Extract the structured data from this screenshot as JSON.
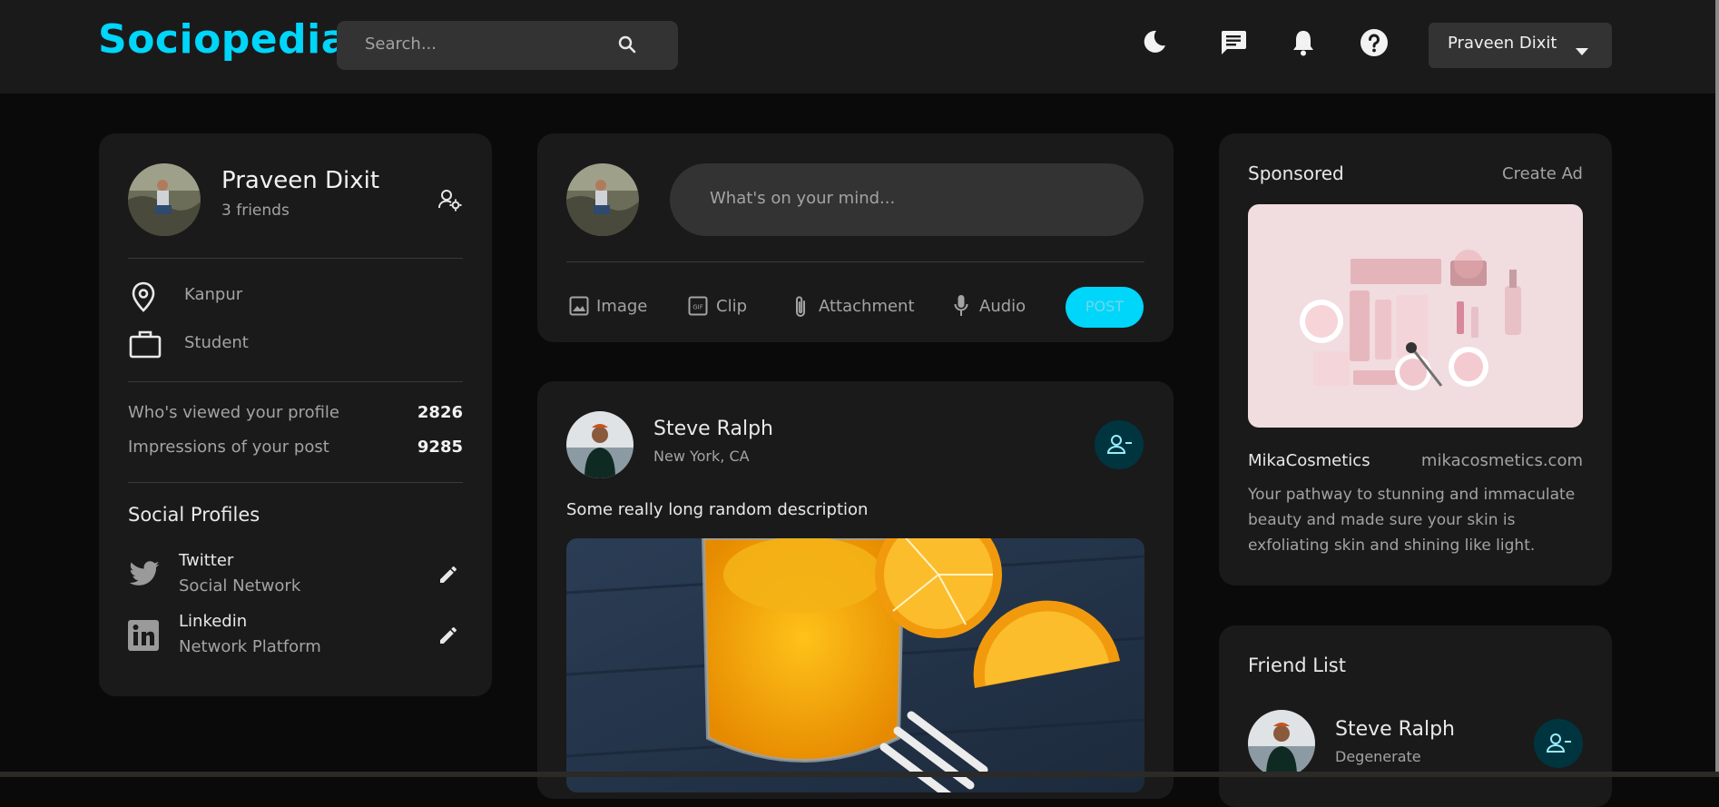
{
  "header": {
    "logo": "Sociopedia",
    "search_placeholder": "Search...",
    "user_name": "Praveen Dixit"
  },
  "profile": {
    "name": "Praveen Dixit",
    "friends": "3 friends",
    "location": "Kanpur",
    "occupation": "Student",
    "viewed_label": "Who's viewed your profile",
    "viewed_value": "2826",
    "impressions_label": "Impressions of your post",
    "impressions_value": "9285",
    "social_title": "Social Profiles",
    "socials": [
      {
        "name": "Twitter",
        "sub": "Social Network",
        "icon": "twitter-icon"
      },
      {
        "name": "Linkedin",
        "sub": "Network Platform",
        "icon": "linkedin-icon"
      }
    ]
  },
  "composer": {
    "placeholder": "What's on your mind...",
    "actions": [
      "Image",
      "Clip",
      "Attachment",
      "Audio"
    ],
    "post_label": "POST"
  },
  "post": {
    "author": "Steve Ralph",
    "location": "New York, CA",
    "description": "Some really long random description"
  },
  "sponsored": {
    "title": "Sponsored",
    "create": "Create Ad",
    "brand": "MikaCosmetics",
    "url": "mikacosmetics.com",
    "text_lines": [
      "Your pathway to stunning and immaculate",
      "beauty and made sure your skin is",
      "exfoliating skin and shining like light."
    ]
  },
  "friends": {
    "title": "Friend List",
    "items": [
      {
        "name": "Steve Ralph",
        "sub": "Degenerate"
      }
    ]
  },
  "colors": {
    "accent": "#00d5fa",
    "card": "#1a1a1a",
    "background": "#0a0a0a",
    "input": "#333333"
  }
}
